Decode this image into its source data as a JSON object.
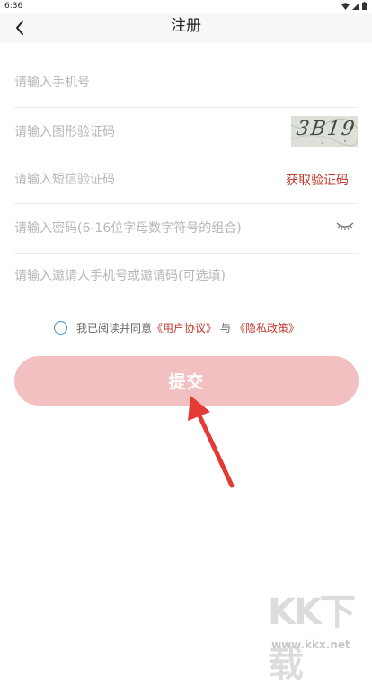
{
  "status_bar": {
    "time": "6:36"
  },
  "header": {
    "title": "注册"
  },
  "form": {
    "phone_placeholder": "请输入手机号",
    "image_code_placeholder": "请输入图形验证码",
    "captcha_text": "3B19",
    "sms_code_placeholder": "请输入短信验证码",
    "sms_button": "获取验证码",
    "password_placeholder": "请输入密码(6-16位字母数字符号的组合)",
    "invite_placeholder": "请输入邀请人手机号或邀请码(可选填)"
  },
  "agreement": {
    "prefix": "我已阅读并同意",
    "user_agreement": "《用户协议》",
    "connector": "与",
    "privacy_policy": "《隐私政策》",
    "checked": false
  },
  "submit": {
    "label": "提交"
  },
  "watermark": {
    "logo": "KK下载",
    "url": "www.kkx.net"
  },
  "colors": {
    "accent": "#c0392b",
    "button": "#f2c0c1",
    "checkbox": "#3a8fd4",
    "arrow": "#e53935"
  },
  "icons": [
    "back-arrow-icon",
    "eye-closed-icon",
    "wifi-icon",
    "signal-icon",
    "battery-icon"
  ]
}
